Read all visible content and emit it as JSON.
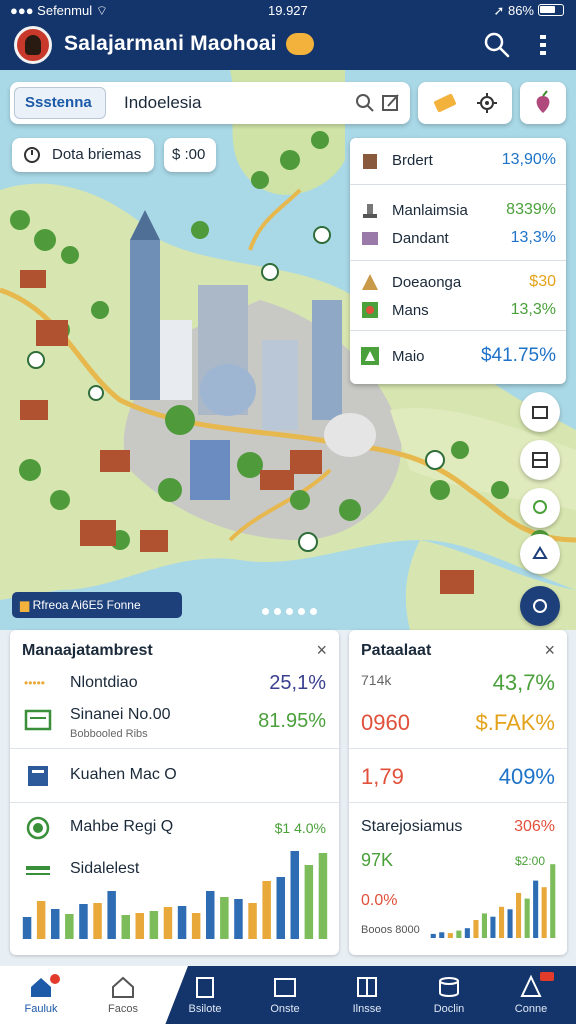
{
  "status": {
    "left": "Sefenmul",
    "time": "19.927",
    "right": "86%"
  },
  "header": {
    "title": "Salajarmani Maohoai"
  },
  "search": {
    "scope": "Ssstenna",
    "query": "Indoelesia"
  },
  "chips": {
    "data_label": "Dota briemas",
    "currency_label": "$ :00"
  },
  "info_card": {
    "rows": [
      {
        "label": "Brdert",
        "value": "13,90%",
        "color": "#1e73c8",
        "icon": "building-icon"
      },
      {
        "label": "Manlaimsia",
        "value": "8339%",
        "color": "#4aa03a",
        "icon": "monument-icon"
      },
      {
        "label": "Dandant",
        "value": "13,3%",
        "color": "#1e73c8",
        "icon": "box-icon"
      },
      {
        "label": "Doeaonga",
        "value": "$30",
        "color": "#e3a21a",
        "icon": "tent-icon"
      },
      {
        "label": "Mans",
        "value": "13,3%",
        "color": "#4aa03a",
        "icon": "leaf-icon"
      },
      {
        "label": "Maio",
        "value": "$41.75%",
        "color": "#1e73c8",
        "icon": "chart-icon"
      }
    ]
  },
  "map": {
    "tag": "Rfreoa Ai6E5 Fonne"
  },
  "left_panel": {
    "title": "Manaajatambrest",
    "rows": [
      {
        "label": "Nlontdiao",
        "value": "25,1%",
        "color": "#3a3f8f"
      },
      {
        "label": "Sinanei No.00",
        "sub": "Bobbooled Ribs",
        "value": "81.95%",
        "color": "#4aa03a"
      },
      {
        "label": "Kuahen Mac O"
      },
      {
        "label": "Mahbe Regi Q",
        "value": "$1 4.0%",
        "color": "#4aa03a"
      },
      {
        "label": "Sidalelest"
      }
    ],
    "bars": [
      {
        "v": 0.22,
        "c": "#2e6db4"
      },
      {
        "v": 0.38,
        "c": "#e8a93a"
      },
      {
        "v": 0.3,
        "c": "#2e6db4"
      },
      {
        "v": 0.25,
        "c": "#7cbc5a"
      },
      {
        "v": 0.35,
        "c": "#2e6db4"
      },
      {
        "v": 0.36,
        "c": "#e8a93a"
      },
      {
        "v": 0.48,
        "c": "#2e6db4"
      },
      {
        "v": 0.24,
        "c": "#7cbc5a"
      },
      {
        "v": 0.26,
        "c": "#e8a93a"
      },
      {
        "v": 0.28,
        "c": "#7cbc5a"
      },
      {
        "v": 0.32,
        "c": "#e8a93a"
      },
      {
        "v": 0.33,
        "c": "#2e6db4"
      },
      {
        "v": 0.26,
        "c": "#e8a93a"
      },
      {
        "v": 0.48,
        "c": "#2e6db4"
      },
      {
        "v": 0.42,
        "c": "#7cbc5a"
      },
      {
        "v": 0.4,
        "c": "#2e6db4"
      },
      {
        "v": 0.36,
        "c": "#e8a93a"
      },
      {
        "v": 0.58,
        "c": "#e8a93a"
      },
      {
        "v": 0.62,
        "c": "#2e6db4"
      },
      {
        "v": 0.88,
        "c": "#2e6db4"
      },
      {
        "v": 0.74,
        "c": "#7cbc5a"
      },
      {
        "v": 0.86,
        "c": "#7cbc5a"
      }
    ]
  },
  "right_panel": {
    "title": "Pataalaat",
    "r1_label": "714k",
    "r1_value": "43,7%",
    "r1_color": "#4aa03a",
    "r2_left": "0960",
    "r2_left_color": "#e0503a",
    "r2_value": "$.FAK%",
    "r2_color": "#e3a21a",
    "r3_left": "1,79",
    "r3_left_color": "#e0503a",
    "r3_value": "409%",
    "r3_color": "#1e73c8",
    "r4_label": "Starejosiamus",
    "r4_value": "306%",
    "r4_color": "#e0503a",
    "r5_left": "97K",
    "r5_left_color": "#4aa03a",
    "r6_left": "0.0%",
    "r6_left_color": "#e0503a",
    "r6_value": "$2:00",
    "r7_label": "Booos 8000",
    "bars": [
      {
        "v": 0.05,
        "c": "#2e6db4"
      },
      {
        "v": 0.07,
        "c": "#2e6db4"
      },
      {
        "v": 0.06,
        "c": "#e8a93a"
      },
      {
        "v": 0.09,
        "c": "#7cbc5a"
      },
      {
        "v": 0.12,
        "c": "#2e6db4"
      },
      {
        "v": 0.22,
        "c": "#e8a93a"
      },
      {
        "v": 0.3,
        "c": "#7cbc5a"
      },
      {
        "v": 0.26,
        "c": "#2e6db4"
      },
      {
        "v": 0.38,
        "c": "#e8a93a"
      },
      {
        "v": 0.35,
        "c": "#2e6db4"
      },
      {
        "v": 0.55,
        "c": "#e8a93a"
      },
      {
        "v": 0.48,
        "c": "#7cbc5a"
      },
      {
        "v": 0.7,
        "c": "#2e6db4"
      },
      {
        "v": 0.62,
        "c": "#e8a93a"
      },
      {
        "v": 0.9,
        "c": "#7cbc5a"
      }
    ]
  },
  "nav": {
    "items": [
      {
        "label": "Fauluk",
        "icon": "home-icon"
      },
      {
        "label": "Facos",
        "icon": "house-icon"
      },
      {
        "label": "Bsilote",
        "icon": "building-icon"
      },
      {
        "label": "Onste",
        "icon": "wallet-icon"
      },
      {
        "label": "Ilnsse",
        "icon": "book-icon"
      },
      {
        "label": "Doclin",
        "icon": "stack-icon"
      },
      {
        "label": "Conne",
        "icon": "person-icon"
      }
    ]
  }
}
